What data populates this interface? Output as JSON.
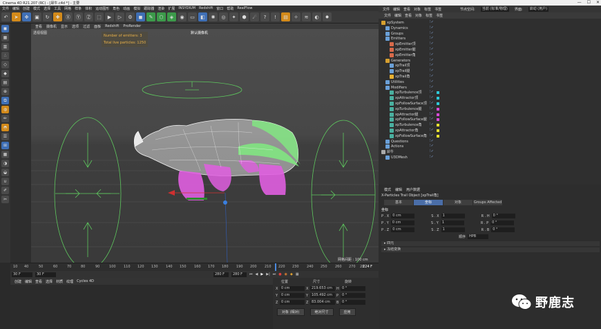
{
  "window": {
    "title": "Cinema 4D R21.207 (RC) - [犀牛.c4d *] - 主要",
    "controls": [
      "—",
      "☐",
      "✕"
    ]
  },
  "menubar": [
    "文件",
    "编辑",
    "创建",
    "模式",
    "选择",
    "工具",
    "网格",
    "样条",
    "体积",
    "运动图形",
    "角色",
    "动画",
    "模拟",
    "跟踪器",
    "渲染",
    "扩展",
    "INSYDIUM",
    "Redshift",
    "窗口",
    "帮助",
    "RealFlow"
  ],
  "viewport": {
    "menu": [
      "查看",
      "摄像机",
      "显示",
      "选项",
      "过滤",
      "面板",
      "Redshift",
      "ProRender"
    ],
    "label": "透视视图",
    "camera": "默认摄像机",
    "info": {
      "emitters": "Number of emitters: 3",
      "particles": "Total live particles: 1250"
    },
    "grid_label": "网格间距 : 100 cm"
  },
  "timeline": {
    "ticks": [
      "10",
      "40",
      "50",
      "60",
      "70",
      "80",
      "90",
      "100",
      "110",
      "120",
      "130",
      "140",
      "150",
      "160",
      "170",
      "180",
      "190",
      "200",
      "210",
      "220",
      "230",
      "240",
      "250",
      "260",
      "270",
      "28"
    ],
    "current": "224 F",
    "start": "30 F",
    "start2": "30 F",
    "end": "280 F",
    "end2": "280 F"
  },
  "material_menu": [
    "创建",
    "编辑",
    "查看",
    "选择",
    "材质",
    "纹理",
    "Cycles 4D"
  ],
  "coords": {
    "headers": [
      "位置",
      "尺寸",
      "旋转"
    ],
    "rows": [
      {
        "axis": "X",
        "pos": "0 cm",
        "size_axis": "X",
        "size": "219.653 cm",
        "rot_axis": "H",
        "rot": "0 °"
      },
      {
        "axis": "Y",
        "pos": "0 cm",
        "size_axis": "Y",
        "size": "105.492 cm",
        "rot_axis": "P",
        "rot": "0 °"
      },
      {
        "axis": "Z",
        "pos": "0 cm",
        "size_axis": "Z",
        "size": "83.004 cm",
        "rot_axis": "B",
        "rot": "0 °"
      }
    ],
    "mode_select": "对象 (相对)",
    "size_select": "绝对尺寸",
    "apply": "应用"
  },
  "object_manager": {
    "top": [
      "文件",
      "编辑",
      "查看",
      "对象",
      "标签",
      "书签"
    ],
    "top_right": [
      "节点空间:",
      "当前 (标准/物理)",
      "界面:",
      "启动 (用户)"
    ],
    "menu": [
      "文件",
      "编辑",
      "查看",
      "对象",
      "标签",
      "书签"
    ],
    "items": [
      {
        "label": "xpSystem",
        "indent": 0,
        "color": "#d6a030"
      },
      {
        "label": "Dynamics",
        "indent": 1,
        "color": "#6aa0d8"
      },
      {
        "label": "Groups",
        "indent": 1,
        "color": "#6aa0d8"
      },
      {
        "label": "Emitters",
        "indent": 1,
        "color": "#6aa0d8"
      },
      {
        "label": "xpEmitter顶",
        "indent": 2,
        "color": "#d86a4a"
      },
      {
        "label": "xpEmitter腿",
        "indent": 2,
        "color": "#d86a4a"
      },
      {
        "label": "xpEmitter角",
        "indent": 2,
        "color": "#d86a4a"
      },
      {
        "label": "Generators",
        "indent": 1,
        "color": "#d6a030"
      },
      {
        "label": "xpTrail顶",
        "indent": 2,
        "color": "#6aa0d8"
      },
      {
        "label": "xpTrail腿",
        "indent": 2,
        "color": "#6aa0d8"
      },
      {
        "label": "xpTrail角",
        "indent": 2,
        "color": "#e8b030"
      },
      {
        "label": "Utilities",
        "indent": 1,
        "color": "#6aa0d8"
      },
      {
        "label": "Modifiers",
        "indent": 1,
        "color": "#6aa0d8"
      },
      {
        "label": "xpTurbulence顶",
        "indent": 2,
        "color": "#4ab0a0"
      },
      {
        "label": "xpAttractor顶",
        "indent": 2,
        "color": "#4ab0a0"
      },
      {
        "label": "xpFollowSurface顶",
        "indent": 2,
        "color": "#4ab0a0"
      },
      {
        "label": "xpTurbulence腿",
        "indent": 2,
        "color": "#4ab0a0"
      },
      {
        "label": "xpAttractor腿",
        "indent": 2,
        "color": "#4ab0a0"
      },
      {
        "label": "xpFollowSurface腿",
        "indent": 2,
        "color": "#4ab0a0"
      },
      {
        "label": "xpTurbulence角",
        "indent": 2,
        "color": "#4ab0a0"
      },
      {
        "label": "xpAttractor角",
        "indent": 2,
        "color": "#4ab0a0"
      },
      {
        "label": "xpFollowSurface角",
        "indent": 2,
        "color": "#4ab0a0"
      },
      {
        "label": "Questions",
        "indent": 1,
        "color": "#6aa0d8"
      },
      {
        "label": "Actions",
        "indent": 1,
        "color": "#6aa0d8"
      },
      {
        "label": "犀牛",
        "indent": 0,
        "color": "#aaaaaa"
      },
      {
        "label": "U3DMesh",
        "indent": 1,
        "color": "#6aa0d8"
      }
    ],
    "tag_colors": [
      "#2ec8d8",
      "#2ec8d8",
      "#2ec8d8",
      "#d84ad8",
      "#d84ad8",
      "#d84ad8",
      "#e8e030",
      "#e8e030",
      "#e8e030"
    ]
  },
  "attributes": {
    "menu": [
      "模式",
      "编辑",
      "用户数据"
    ],
    "title": "X-Particles Trail Object [xpTrail角]",
    "tabs": [
      "基本",
      "坐标",
      "对象",
      "Groups Affected"
    ],
    "active_tab": "坐标",
    "section": "坐标",
    "rows": [
      {
        "a": "P . X",
        "av": "0 cm",
        "b": "S . X",
        "bv": "1",
        "c": "R . H",
        "cv": "0 °"
      },
      {
        "a": "P . Y",
        "av": "0 cm",
        "b": "S . Y",
        "bv": "1",
        "c": "R . P",
        "cv": "0 °"
      },
      {
        "a": "P . Z",
        "av": "0 cm",
        "b": "S . Z",
        "bv": "1",
        "c": "R . B",
        "cv": "0 °"
      }
    ],
    "order_label": "顺序",
    "order_value": "HPB",
    "collapsed": [
      "▸ 四元",
      "▸ 冻结变换"
    ]
  },
  "watermark": "野鹿志",
  "colors": {
    "trail_white": "#e8e8e8",
    "trail_green": "#7ff07f",
    "trail_magenta": "#e05ee0",
    "helper_green": "#5ec85e"
  }
}
